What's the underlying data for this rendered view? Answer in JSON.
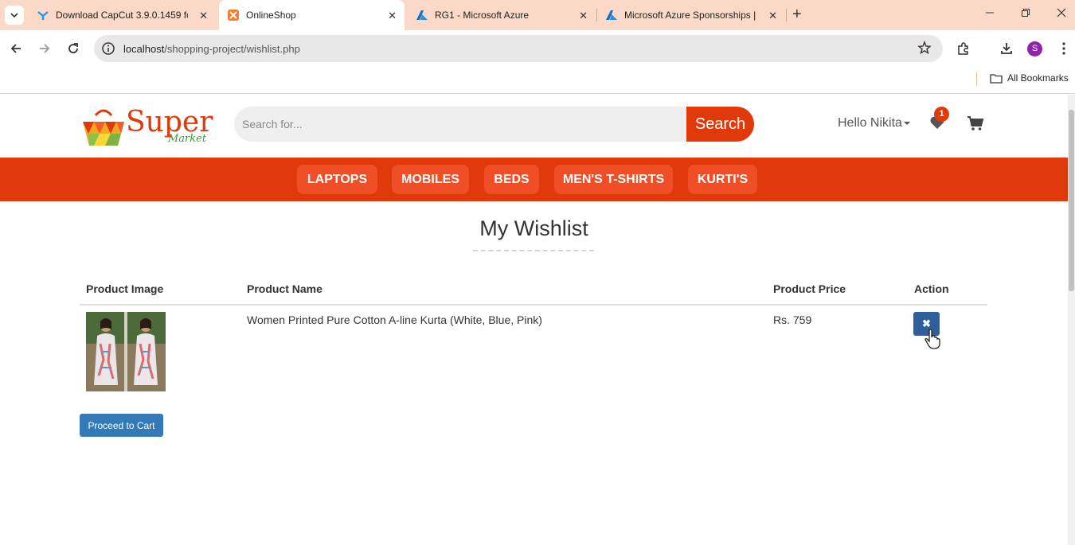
{
  "browser": {
    "tabs": [
      {
        "title": "Download CapCut 3.9.0.1459 fo",
        "icon": "capcut-icon",
        "active": false
      },
      {
        "title": "OnlineShop",
        "icon": "xampp-icon",
        "active": true
      },
      {
        "title": "RG1 - Microsoft Azure",
        "icon": "azure-icon",
        "active": false
      },
      {
        "title": "Microsoft Azure Sponsorships |",
        "icon": "azure-icon",
        "active": false
      }
    ],
    "close_glyph": "✕",
    "new_tab_glyph": "+",
    "url_host": "localhost",
    "url_path": "/shopping-project/wishlist.php",
    "profile_initial": "S",
    "all_bookmarks": "All Bookmarks"
  },
  "header": {
    "logo_word": "Super",
    "logo_sub": "Market",
    "search_placeholder": "Search for...",
    "search_button": "Search",
    "greeting": "Hello Nikita",
    "wishlist_count": "1"
  },
  "categories": [
    "LAPTOPS",
    "MOBILES",
    "BEDS",
    "MEN'S T-SHIRTS",
    "KURTI'S"
  ],
  "main": {
    "title": "My Wishlist",
    "columns": [
      "Product Image",
      "Product Name",
      "Product Price",
      "Action"
    ],
    "rows": [
      {
        "name": "Women Printed Pure Cotton A-line Kurta (White, Blue, Pink)",
        "price": "Rs. 759",
        "action_glyph": "✖"
      }
    ],
    "proceed_label": "Proceed to Cart"
  },
  "colors": {
    "brand": "#e03a0c",
    "category_button": "#f04e27",
    "delete_button": "#2f5f9a",
    "proceed_button": "#337ab7"
  }
}
